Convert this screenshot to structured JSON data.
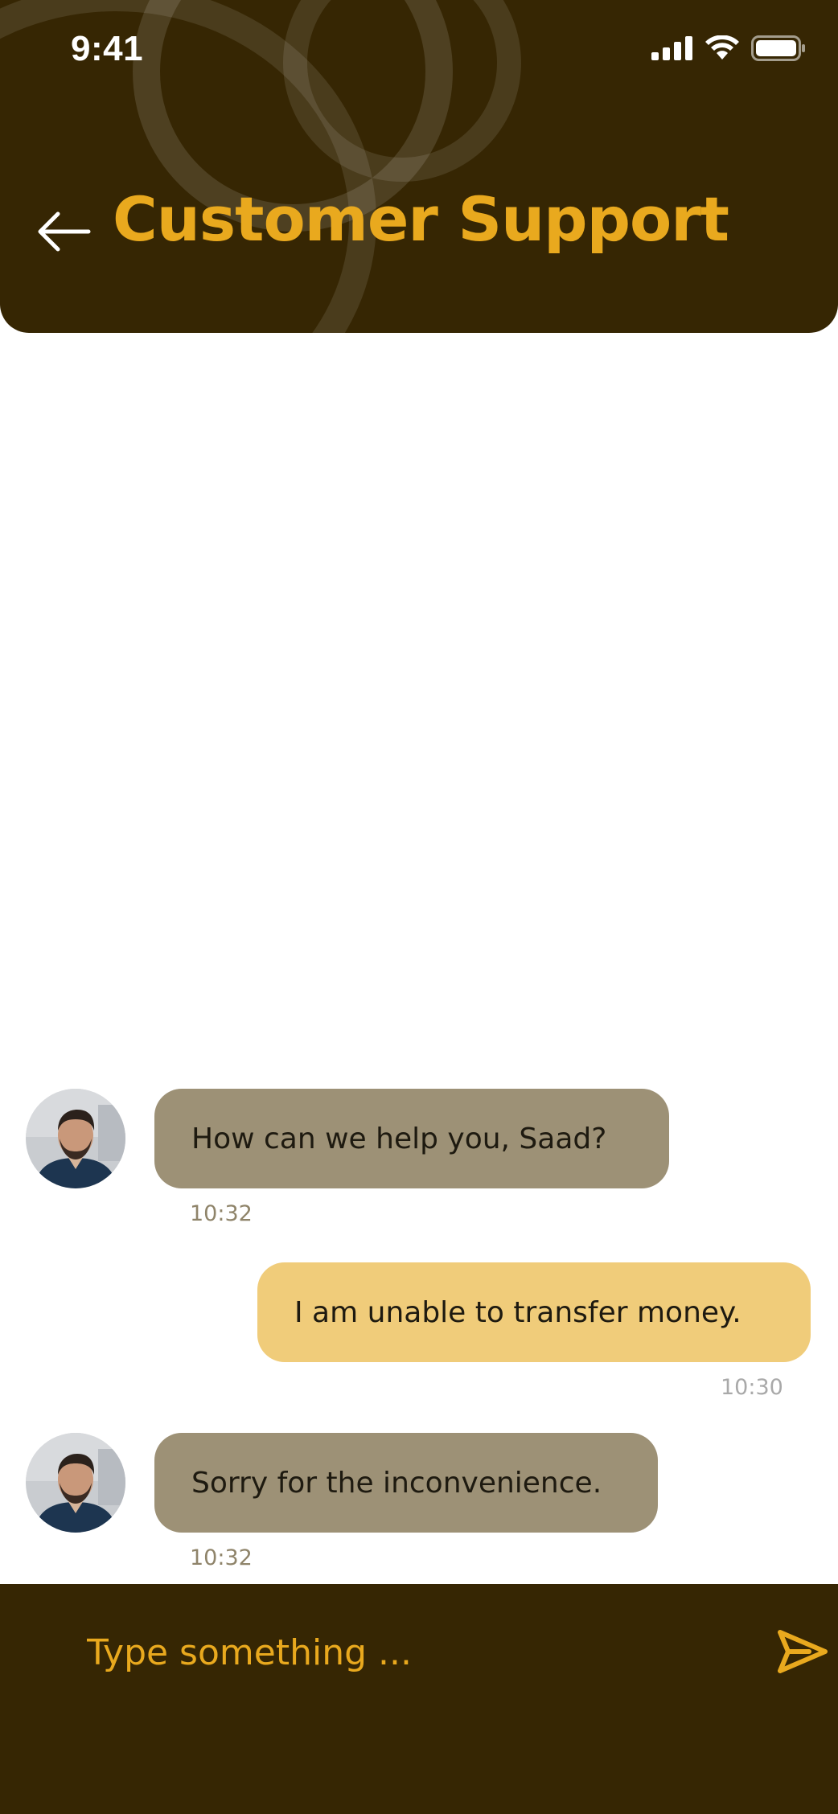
{
  "status_bar": {
    "time": "9:41",
    "icons": [
      "cellular-signal-icon",
      "wifi-icon",
      "battery-icon"
    ]
  },
  "header": {
    "title": "Customer Support",
    "back_icon": "arrow-left-icon"
  },
  "messages": [
    {
      "direction": "incoming",
      "text": "How can we help you, Saad?",
      "time": "10:32"
    },
    {
      "direction": "outgoing",
      "text": "I am unable to transfer money.",
      "time": "10:30"
    },
    {
      "direction": "incoming",
      "text": "Sorry for the inconvenience.",
      "time": "10:32"
    }
  ],
  "composer": {
    "placeholder": "Type something ...",
    "send_icon": "send-icon"
  },
  "colors": {
    "header_bg": "#362603",
    "accent": "#E9A91E",
    "incoming_bubble": "#9D9176",
    "outgoing_bubble": "#F0CC7A"
  }
}
